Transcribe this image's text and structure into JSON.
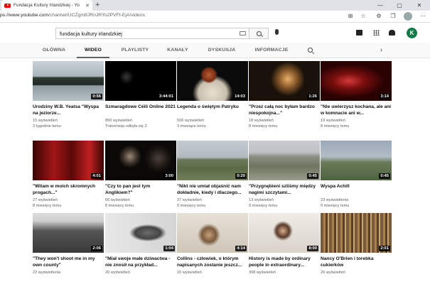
{
  "browser": {
    "tab_title": "Fundacja Kultury Irlandzkiej - Yo",
    "tab_close": "✕",
    "new_tab": "+",
    "url_prefix": "ps://www.youtube.com",
    "url_path": "/channel/UCZgm9JRnJRYo2PVFt-EjA/videos",
    "win_min": "—",
    "win_max": "▢",
    "win_close": "✕"
  },
  "header": {
    "search_value": "fundacja kultury irlandzkiej",
    "avatar_letter": "K"
  },
  "channel_tabs": [
    "GŁÓWNA",
    "WIDEO",
    "PLAYLISTY",
    "KANAŁY",
    "DYSKUSJA",
    "INFORMACJE"
  ],
  "active_tab": "WIDEO",
  "videos": [
    {
      "title": "Urodziny W.B. Yeatsa \"Wyspa na jeziorze...",
      "views": "15 wyświetleń",
      "age": "3 tygodnie temu",
      "duration": "0:56",
      "theme": "lake"
    },
    {
      "title": "Szmaragdowe Céili Online 2021",
      "views": "850 wyświetleń",
      "age": "Transmisja odbyła się 3",
      "duration": "3:44:01",
      "theme": "dark"
    },
    {
      "title": "Legenda o świętym Patryku",
      "views": "506 wyświetleń",
      "age": "3 miesiące temu",
      "duration": "14:03",
      "theme": "patrick"
    },
    {
      "title": "\"Przez całą noc byłam bardzo niespokojna...\"",
      "views": "18 wyświetleń",
      "age": "8 miesięcy temu",
      "duration": "1:26",
      "theme": "candle"
    },
    {
      "title": "\"Nie uwierzysz kochana, ale ani w komnacie ani w...",
      "views": "19 wyświetleń",
      "age": "8 miesięcy temu",
      "duration": "3:14",
      "theme": "red"
    },
    {
      "title": "\"Witam w moich skromnych progach...\"",
      "views": "27 wyświetleń",
      "age": "8 miesięcy temu",
      "duration": "4:01",
      "theme": "curtain"
    },
    {
      "title": "\"Czy to pan jest tym Anglikiem?\"",
      "views": "66 wyświetleń",
      "age": "8 miesięcy temu",
      "duration": "3:00",
      "theme": "darkman"
    },
    {
      "title": "\"Nikt nie umiał objaśnić nam dokładnie, kiedy i dlaczego...",
      "views": "27 wyświetleń",
      "age": "9 miesięcy temu",
      "duration": "0:20",
      "theme": "hills"
    },
    {
      "title": "\"Przygnębieni szliśmy między nagimi szczytami...",
      "views": "13 wyświetleń",
      "age": "9 miesięcy temu",
      "duration": "0:45",
      "theme": "rocks"
    },
    {
      "title": "Wyspa Achill",
      "views": "23 wyświetlenia",
      "age": "9 miesięcy temu",
      "duration": "0:45",
      "theme": "achill"
    },
    {
      "title": "\"They won't shoot me in my own county\"",
      "views": "22 wyświetlenia",
      "age": "",
      "duration": "2:06",
      "theme": "photo1"
    },
    {
      "title": "\"Miał swoje małe dziwactwa - nie znosił na przykład...",
      "views": "20 wyświetleń",
      "age": "",
      "duration": "1:04",
      "theme": "photo2"
    },
    {
      "title": "Collins - człowiek, o którym napisanych zostanie jeszcz...",
      "views": "15 wyświetleń",
      "age": "",
      "duration": "4:14",
      "theme": "office"
    },
    {
      "title": "History is made by ordinary people in extraordinary...",
      "views": "308 wyświetleń",
      "age": "",
      "duration": "8:00",
      "theme": "woman"
    },
    {
      "title": "Nancy O'Brien i torebka cukierków",
      "views": "26 wyświetleń",
      "age": "",
      "duration": "2:01",
      "theme": "books"
    }
  ],
  "colors": {
    "accent": "#137a4a",
    "youtube_red": "#ff0000"
  }
}
